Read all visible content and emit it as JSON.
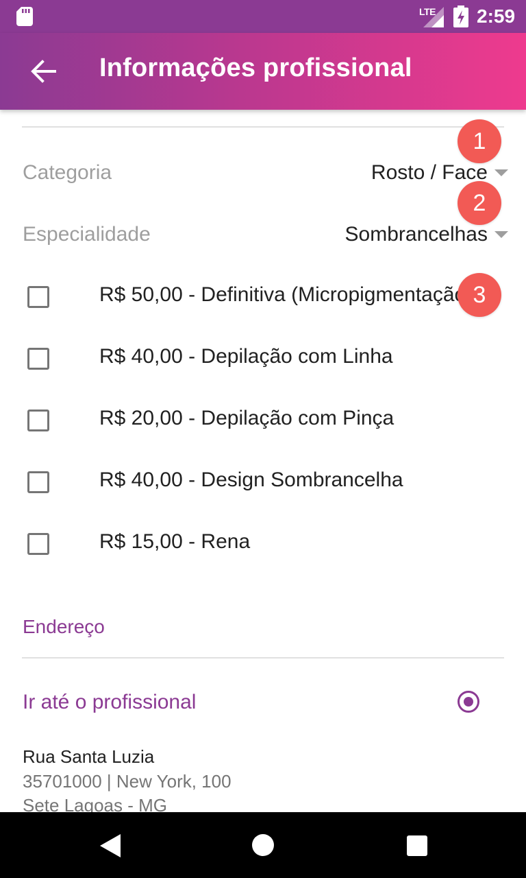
{
  "status_bar": {
    "network": "LTE",
    "time": "2:59",
    "icons": [
      "sd-card-icon",
      "signal-icon",
      "battery-charging-icon"
    ]
  },
  "app_bar": {
    "title": "Informações profissional",
    "back_icon": "arrow-back-icon"
  },
  "form": {
    "category": {
      "label": "Categoria",
      "value": "Rosto / Face"
    },
    "specialty": {
      "label": "Especialidade",
      "value": "Sombrancelhas"
    },
    "services": [
      {
        "label": "R$ 50,00 - Definitiva (Micropigmentação)",
        "checked": false
      },
      {
        "label": "R$ 40,00 - Depilação com Linha",
        "checked": false
      },
      {
        "label": "R$ 20,00 - Depilação com Pinça",
        "checked": false
      },
      {
        "label": "R$ 40,00 - Design Sombrancelha",
        "checked": false
      },
      {
        "label": "R$ 15,00 - Rena",
        "checked": false
      }
    ]
  },
  "badges": [
    "1",
    "2",
    "3"
  ],
  "address": {
    "section_title": "Endereço",
    "option_label": "Ir até o profissional",
    "option_selected": true,
    "street": "Rua Santa Luzia",
    "line2": "35701000 | New York, 100",
    "line3": "Sete Lagoas - MG"
  },
  "colors": {
    "primary": "#8b3a93",
    "accent_pink": "#ee3a8e",
    "badge": "#f25a55"
  }
}
